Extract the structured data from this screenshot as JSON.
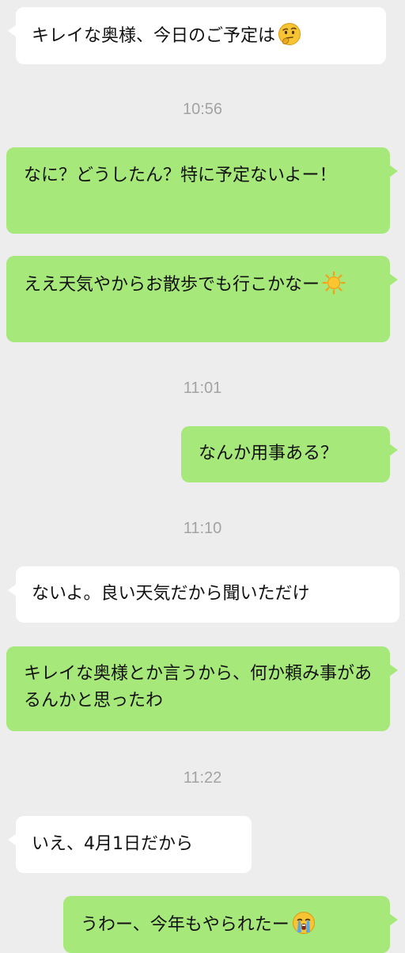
{
  "messages": [
    {
      "id": "m1",
      "side": "in",
      "text": "キレイな奥様、今日のご予定は",
      "emoji": "thinking-face-icon"
    },
    {
      "id": "t1",
      "type": "time",
      "text": "10:56"
    },
    {
      "id": "m2",
      "side": "out",
      "text": "なに？どうしたん？特に予定ないよー！"
    },
    {
      "id": "m3",
      "side": "out",
      "text": "ええ天気やからお散歩でも行こかなー",
      "emoji": "sun-icon"
    },
    {
      "id": "t2",
      "type": "time",
      "text": "11:01"
    },
    {
      "id": "m4",
      "side": "out",
      "text": "なんか用事ある？"
    },
    {
      "id": "t3",
      "type": "time",
      "text": "11:10"
    },
    {
      "id": "m5",
      "side": "in",
      "text": "ないよ。良い天気だから聞いただけ"
    },
    {
      "id": "m6",
      "side": "out",
      "text": "キレイな奥様とか言うから、何か頼み事があるんかと思ったわ"
    },
    {
      "id": "t4",
      "type": "time",
      "text": "11:22"
    },
    {
      "id": "m7",
      "side": "in",
      "text": "いえ、4月1日だから"
    },
    {
      "id": "m8",
      "side": "out",
      "text": "うわー、今年もやられたー",
      "emoji": "crying-face-icon"
    }
  ],
  "colors": {
    "background": "#ededed",
    "incoming_bubble": "#ffffff",
    "outgoing_bubble": "#a7e87a",
    "timestamp_text": "#a3a3a3"
  }
}
